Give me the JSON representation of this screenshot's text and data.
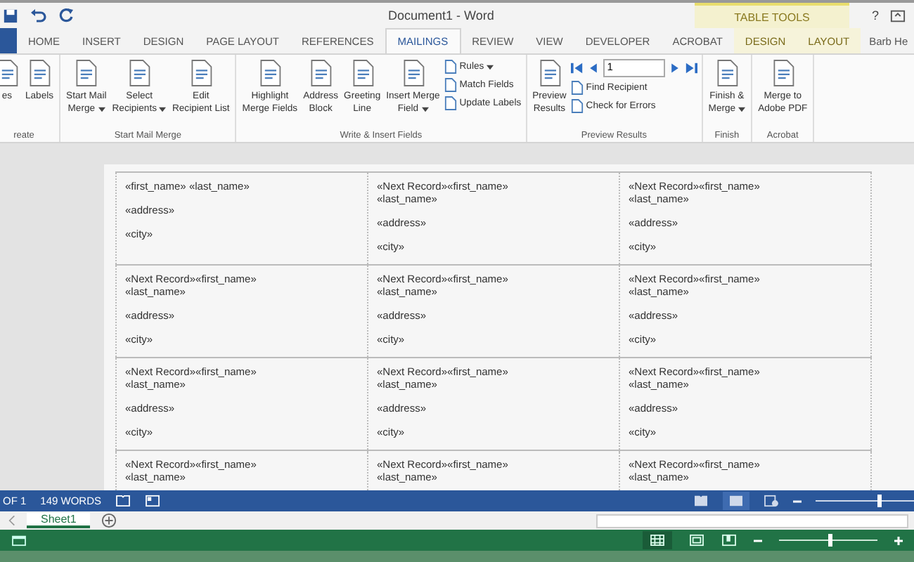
{
  "title_bar": {
    "title": "Document1 - Word",
    "context_title": "TABLE TOOLS",
    "help": "?"
  },
  "tabs": [
    {
      "label": "HOME",
      "selected": false,
      "context": false
    },
    {
      "label": "INSERT",
      "selected": false,
      "context": false
    },
    {
      "label": "DESIGN",
      "selected": false,
      "context": false
    },
    {
      "label": "PAGE LAYOUT",
      "selected": false,
      "context": false
    },
    {
      "label": "REFERENCES",
      "selected": false,
      "context": false
    },
    {
      "label": "MAILINGS",
      "selected": true,
      "context": false
    },
    {
      "label": "REVIEW",
      "selected": false,
      "context": false
    },
    {
      "label": "VIEW",
      "selected": false,
      "context": false
    },
    {
      "label": "DEVELOPER",
      "selected": false,
      "context": false
    },
    {
      "label": "ACROBAT",
      "selected": false,
      "context": false
    },
    {
      "label": "DESIGN",
      "selected": false,
      "context": true
    },
    {
      "label": "LAYOUT",
      "selected": false,
      "context": true
    }
  ],
  "user": "Barb He",
  "ribbon_groups": [
    {
      "label": "reate",
      "items": [
        {
          "kind": "big",
          "lines": [
            "es"
          ],
          "dropdown": false
        },
        {
          "kind": "big",
          "lines": [
            "Labels"
          ],
          "dropdown": false
        }
      ]
    },
    {
      "label": "Start Mail Merge",
      "items": [
        {
          "kind": "big",
          "lines": [
            "Start Mail",
            "Merge"
          ],
          "dropdown": true
        },
        {
          "kind": "big",
          "lines": [
            "Select",
            "Recipients"
          ],
          "dropdown": true
        },
        {
          "kind": "big",
          "lines": [
            "Edit",
            "Recipient List"
          ],
          "dropdown": false
        }
      ]
    },
    {
      "label": "Write & Insert Fields",
      "items": [
        {
          "kind": "big",
          "lines": [
            "Highlight",
            "Merge Fields"
          ],
          "dropdown": false
        },
        {
          "kind": "big",
          "lines": [
            "Address",
            "Block"
          ],
          "dropdown": false
        },
        {
          "kind": "big",
          "lines": [
            "Greeting",
            "Line"
          ],
          "dropdown": false
        },
        {
          "kind": "big",
          "lines": [
            "Insert Merge",
            "Field"
          ],
          "dropdown": true
        },
        {
          "kind": "small",
          "entries": [
            {
              "label": "Rules",
              "dropdown": true
            },
            {
              "label": "Match Fields",
              "dropdown": false
            },
            {
              "label": "Update Labels",
              "dropdown": false
            }
          ]
        }
      ]
    },
    {
      "label": "Preview Results",
      "items": [
        {
          "kind": "big",
          "lines": [
            "Preview",
            "Results"
          ],
          "dropdown": false
        },
        {
          "kind": "nav",
          "record": "1",
          "entries": [
            {
              "label": "Find Recipient"
            },
            {
              "label": "Check for Errors"
            }
          ]
        }
      ]
    },
    {
      "label": "Finish",
      "items": [
        {
          "kind": "big",
          "lines": [
            "Finish &",
            "Merge"
          ],
          "dropdown": true
        }
      ]
    },
    {
      "label": "Acrobat",
      "items": [
        {
          "kind": "big",
          "lines": [
            "Merge to",
            "Adobe PDF"
          ],
          "dropdown": false
        }
      ]
    }
  ],
  "table": {
    "rows": [
      [
        {
          "paragraphs": [
            [
              "«first_name» «last_name»"
            ],
            [
              "«address»"
            ],
            [
              "«city»"
            ]
          ]
        },
        {
          "paragraphs": [
            [
              "«Next Record»«first_name»",
              "«last_name»"
            ],
            [
              "«address»"
            ],
            [
              "«city»"
            ]
          ]
        },
        {
          "paragraphs": [
            [
              "«Next Record»«first_name»",
              "«last_name»"
            ],
            [
              "«address»"
            ],
            [
              "«city»"
            ]
          ]
        }
      ],
      [
        {
          "paragraphs": [
            [
              "«Next Record»«first_name»",
              "«last_name»"
            ],
            [
              "«address»"
            ],
            [
              "«city»"
            ]
          ]
        },
        {
          "paragraphs": [
            [
              "«Next Record»«first_name»",
              "«last_name»"
            ],
            [
              "«address»"
            ],
            [
              "«city»"
            ]
          ]
        },
        {
          "paragraphs": [
            [
              "«Next Record»«first_name»",
              "«last_name»"
            ],
            [
              "«address»"
            ],
            [
              "«city»"
            ]
          ]
        }
      ],
      [
        {
          "paragraphs": [
            [
              "«Next Record»«first_name»",
              "«last_name»"
            ],
            [
              "«address»"
            ],
            [
              "«city»"
            ]
          ]
        },
        {
          "paragraphs": [
            [
              "«Next Record»«first_name»",
              "«last_name»"
            ],
            [
              "«address»"
            ],
            [
              "«city»"
            ]
          ]
        },
        {
          "paragraphs": [
            [
              "«Next Record»«first_name»",
              "«last_name»"
            ],
            [
              "«address»"
            ],
            [
              "«city»"
            ]
          ]
        }
      ],
      [
        {
          "paragraphs": [
            [
              "«Next Record»«first_name»",
              "«last_name»"
            ]
          ]
        },
        {
          "paragraphs": [
            [
              "«Next Record»«first_name»",
              "«last_name»"
            ]
          ]
        },
        {
          "paragraphs": [
            [
              "«Next Record»«first_name»",
              "«last_name»"
            ]
          ]
        }
      ]
    ]
  },
  "word_status": {
    "page": "OF 1",
    "words": "149 WORDS",
    "zoom": {
      "level": 0.5
    }
  },
  "excel": {
    "sheets": [
      {
        "label": "Sheet1",
        "selected": true
      }
    ],
    "zoom": {
      "level": 0.52
    }
  }
}
